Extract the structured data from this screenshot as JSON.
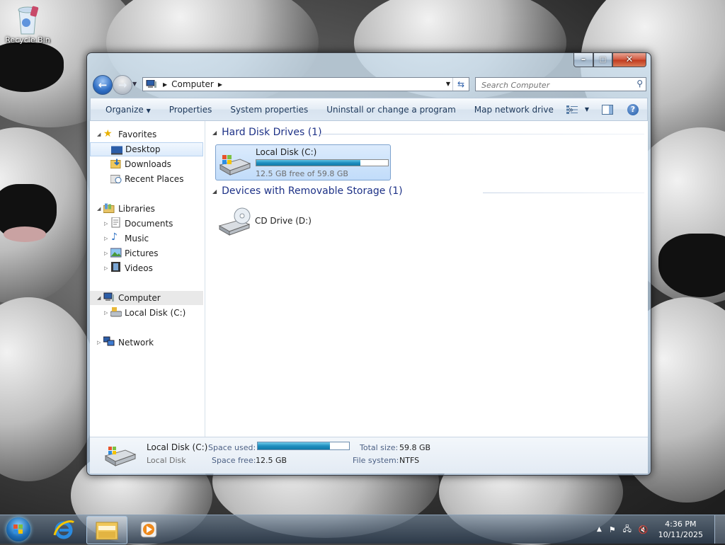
{
  "desktop": {
    "recycle_bin_label": "Recycle Bin"
  },
  "window": {
    "address": {
      "crumb": "Computer"
    },
    "search": {
      "placeholder": "Search Computer"
    },
    "toolbar": {
      "organize": "Organize",
      "properties": "Properties",
      "system_properties": "System properties",
      "uninstall": "Uninstall or change a program",
      "map_network_drive": "Map network drive",
      "more": "»"
    },
    "nav": {
      "favorites": "Favorites",
      "desktop": "Desktop",
      "downloads": "Downloads",
      "recent_places": "Recent Places",
      "libraries": "Libraries",
      "documents": "Documents",
      "music": "Music",
      "pictures": "Pictures",
      "videos": "Videos",
      "computer": "Computer",
      "local_disk": "Local Disk (C:)",
      "network": "Network"
    },
    "content": {
      "hard_disk_header": "Hard Disk Drives (1)",
      "removable_header": "Devices with Removable Storage (1)",
      "drive_c": {
        "name": "Local Disk (C:)",
        "free_text": "12.5 GB free of 59.8 GB",
        "used_fraction": 0.79
      },
      "drive_d": {
        "name": "CD Drive (D:)"
      }
    },
    "details": {
      "name": "Local Disk (C:)",
      "type": "Local Disk",
      "space_used_label": "Space used:",
      "space_free_label": "Space free:",
      "space_free_value": "12.5 GB",
      "total_size_label": "Total size:",
      "total_size_value": "59.8 GB",
      "file_system_label": "File system:",
      "file_system_value": "NTFS"
    }
  },
  "taskbar": {
    "clock_time": "4:36 PM",
    "clock_date": "10/11/2025"
  },
  "colors": {
    "accent": "#1f8fc0",
    "header_text": "#1e3287"
  }
}
